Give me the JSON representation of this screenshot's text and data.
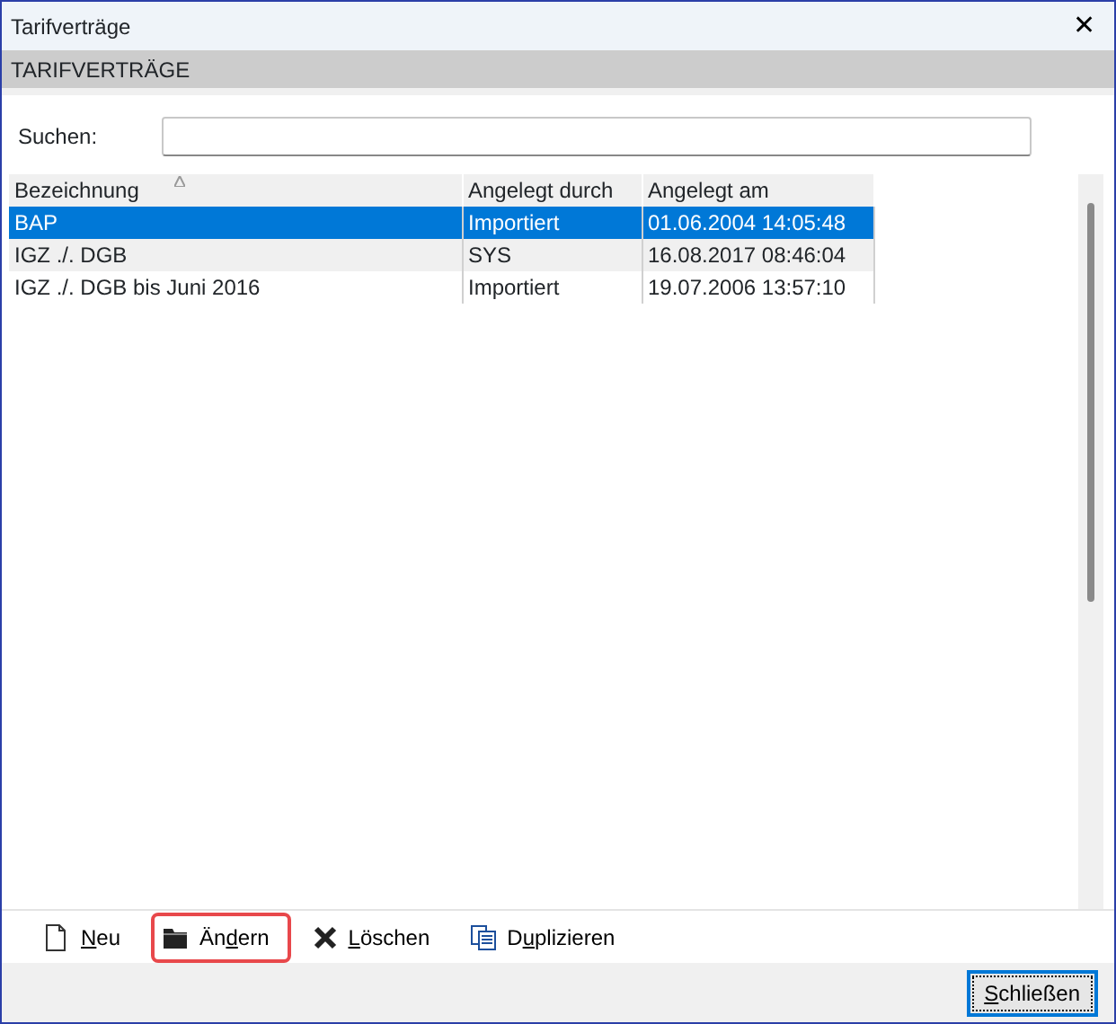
{
  "window": {
    "title": "Tarifverträge",
    "close": "✕"
  },
  "header": "TARIFVERTRÄGE",
  "search": {
    "label": "Suchen:"
  },
  "table": {
    "columns": [
      {
        "label": "Bezeichnung",
        "sorted": true
      },
      {
        "label": "Angelegt durch",
        "sorted": false
      },
      {
        "label": "Angelegt am",
        "sorted": false
      }
    ],
    "rows": [
      {
        "cells": [
          "BAP",
          "Importiert",
          "01.06.2004 14:05:48"
        ],
        "selected": true
      },
      {
        "cells": [
          "IGZ ./. DGB",
          "SYS",
          "16.08.2017 08:46:04"
        ],
        "selected": false
      },
      {
        "cells": [
          "IGZ ./. DGB bis Juni 2016",
          "Importiert",
          "19.07.2006 13:57:10"
        ],
        "selected": false
      }
    ]
  },
  "toolbar": [
    {
      "kind": "new",
      "label": {
        "key": "N",
        "post": "eu"
      },
      "highlighted": false
    },
    {
      "kind": "edit",
      "label": {
        "pre": "Än",
        "key": "d",
        "post": "ern"
      },
      "highlighted": true
    },
    {
      "kind": "delete",
      "label": {
        "key": "L",
        "post": "öschen"
      },
      "highlighted": false
    },
    {
      "kind": "duplicate",
      "label": {
        "pre": "D",
        "key": "u",
        "post": "plizieren"
      },
      "highlighted": false
    }
  ],
  "footer": {
    "close_button": {
      "label": {
        "key": "S",
        "post": "chließen"
      },
      "focused": true
    }
  }
}
